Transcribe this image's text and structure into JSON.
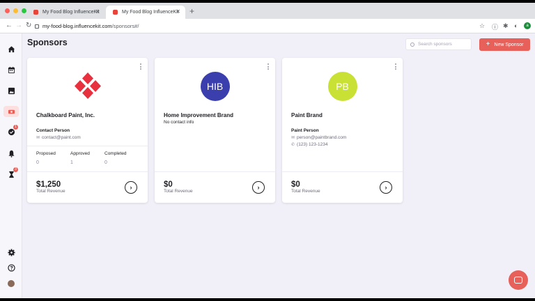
{
  "browser": {
    "tabs": [
      {
        "label": "My Food Blog InfluenceKit",
        "close": "✕"
      },
      {
        "label": "My Food Blog InfluenceKit",
        "close": "✕"
      }
    ],
    "new_tab": "+",
    "url_host": "my-food-blog.influencekit.com",
    "url_path": "/sponsors#/",
    "profile_initial": "a"
  },
  "header": {
    "title": "Sponsors",
    "search_placeholder": "Search sponsors",
    "new_button_label": "New Sponsor",
    "new_button_plus": "+"
  },
  "sidebar": {
    "icons": [
      "home-icon",
      "calendar-icon",
      "image-icon",
      "sponsors-icon",
      "check-icon",
      "bell-icon",
      "hourglass-icon",
      "settings-icon",
      "help-icon",
      "user-avatar"
    ],
    "badges": {
      "check": "1",
      "hourglass": "3"
    }
  },
  "sponsors": [
    {
      "name": "Chalkboard Paint, Inc.",
      "contact_label": "Contact Person",
      "email": "contact@paint.com",
      "stats": [
        {
          "label": "Proposed",
          "value": "0"
        },
        {
          "label": "Approved",
          "value": "1"
        },
        {
          "label": "Completed",
          "value": "0"
        }
      ],
      "revenue": "$1,250",
      "revenue_label": "Total Revenue",
      "logo_color": "#e8313f"
    },
    {
      "name": "Home Improvement Brand",
      "initials": "HIB",
      "no_contact": "No contact info",
      "revenue": "$0",
      "revenue_label": "Total Revenue",
      "avatar_bg": "#3b3fae",
      "avatar_fg": "#ffffff"
    },
    {
      "name": "Paint Brand",
      "initials": "PB",
      "contact_label": "Paint Person",
      "email": "person@paintbrand.com",
      "phone": "(123) 123-1234",
      "revenue": "$0",
      "revenue_label": "Total Revenue",
      "avatar_bg": "#c9e034",
      "avatar_fg": "#ffffff"
    }
  ],
  "colors": {
    "accent": "#e8605a",
    "background": "#f1eff7"
  }
}
